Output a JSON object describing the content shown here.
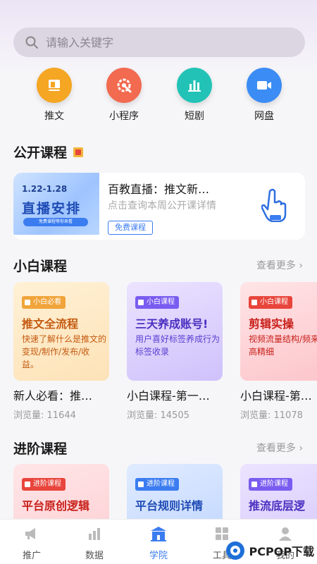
{
  "search": {
    "placeholder": "请输入关键字"
  },
  "quick_actions": [
    {
      "label": "推文",
      "icon": "book-icon",
      "color": "#f5a623"
    },
    {
      "label": "小程序",
      "icon": "gear-icon",
      "color": "#f26a4f"
    },
    {
      "label": "短剧",
      "icon": "bar-chart-icon",
      "color": "#22c3b6"
    },
    {
      "label": "网盘",
      "icon": "video-icon",
      "color": "#3b8cf5"
    }
  ],
  "public": {
    "title": "公开课程",
    "banner": {
      "dates": "1.22-1.28",
      "headline": "直播安排",
      "strip": "免费课程等你来看"
    },
    "card_title": "百教直播：推文新…",
    "card_sub": "点击查询本周公开课详情",
    "button": "免费课程"
  },
  "beginner": {
    "title": "小白课程",
    "more": "查看更多",
    "items": [
      {
        "tag": "小白必看",
        "head": "推文全流程",
        "desc": "快速了解什么是推文的变现/制作/发布/收益。",
        "title": "新人必看：推…",
        "views": "浏览量: 11644"
      },
      {
        "tag": "小白课程",
        "head": "三天养成账号!",
        "desc": "用户喜好标签养成行为标签收录",
        "title": "小白课程-第一…",
        "views": "浏览量: 14505"
      },
      {
        "tag": "小白课程",
        "head": "剪辑实操",
        "desc": "视频流量结构/频来源/高精细",
        "title": "小白课程-第…",
        "views": "浏览量: 11078"
      }
    ]
  },
  "advanced": {
    "title": "进阶课程",
    "more": "查看更多",
    "items": [
      {
        "tag": "进阶课程",
        "head": "平台原创逻辑"
      },
      {
        "tag": "进阶课程",
        "head": "平台规则详情"
      },
      {
        "tag": "进阶课程",
        "head": "推流底层逻"
      }
    ]
  },
  "tabs": [
    {
      "label": "推广",
      "icon": "megaphone-icon"
    },
    {
      "label": "数据",
      "icon": "chart-icon"
    },
    {
      "label": "学院",
      "icon": "school-icon",
      "active": true
    },
    {
      "label": "工具",
      "icon": "tools-icon"
    },
    {
      "label": "我的",
      "icon": "user-icon"
    }
  ],
  "watermark": {
    "text": "PCPOP下载"
  }
}
